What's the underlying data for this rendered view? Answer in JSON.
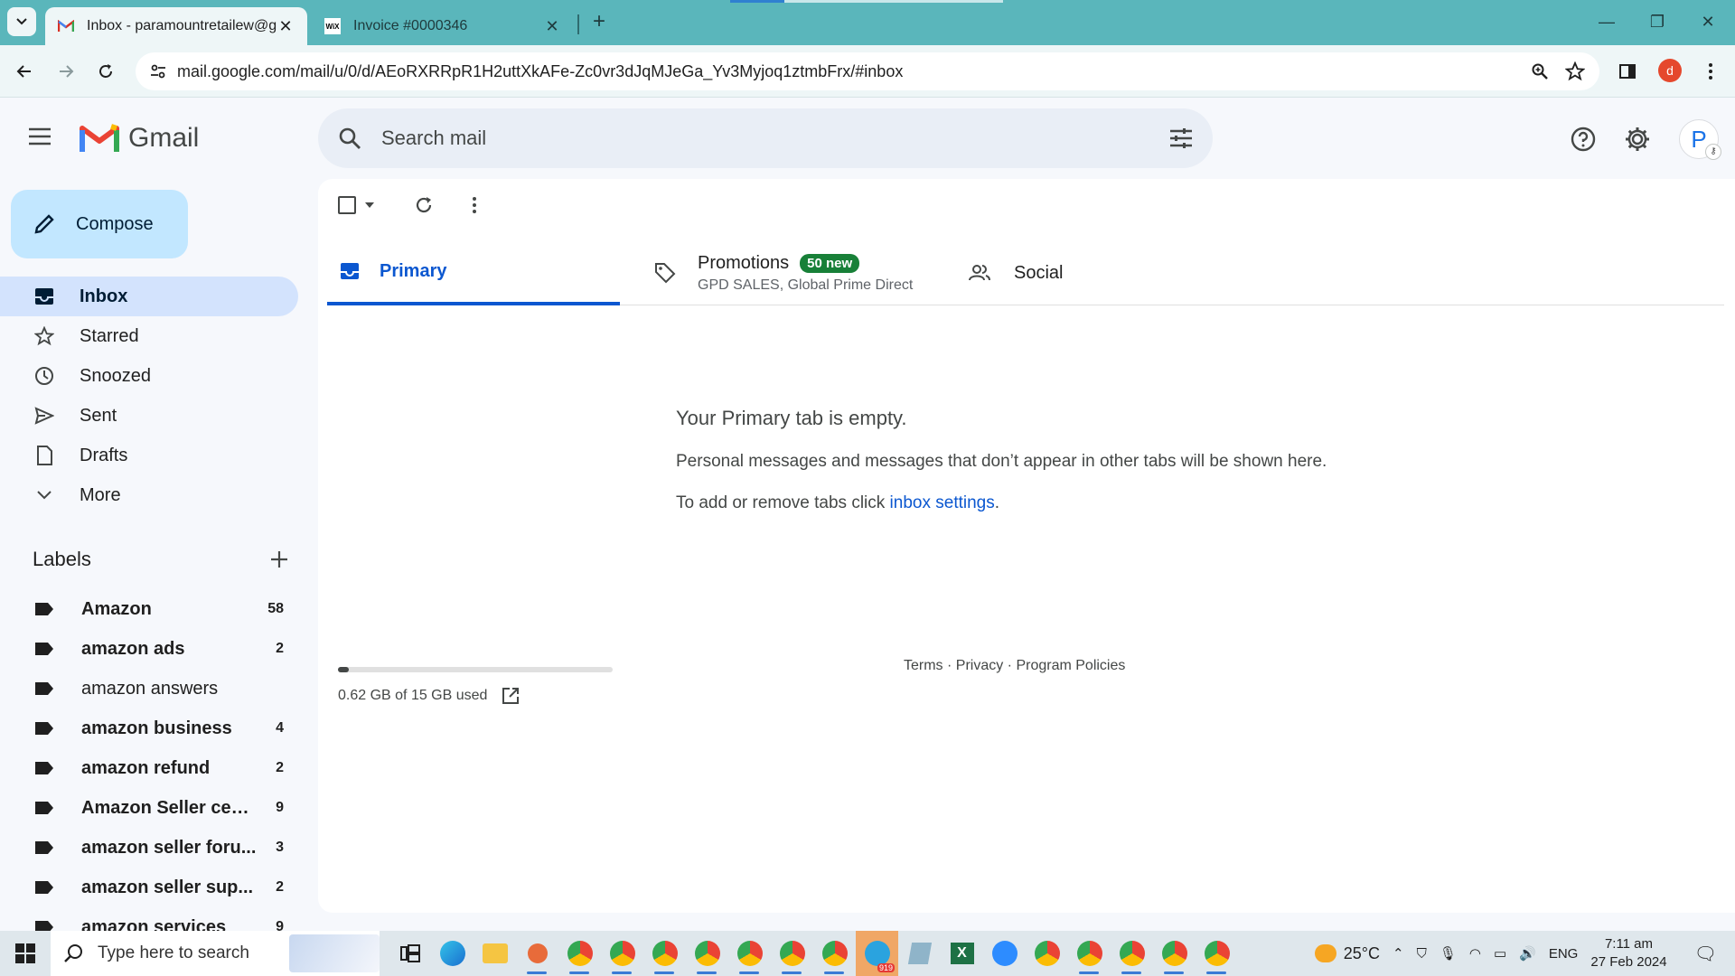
{
  "browser": {
    "tabs": [
      {
        "title": "Inbox - paramountretailew@gm",
        "favicon": "gmail-icon",
        "active": true
      },
      {
        "title": "Invoice #0000346",
        "favicon": "wix-icon",
        "active": false
      }
    ],
    "url": "mail.google.com/mail/u/0/d/AEoRXRRpR1H2uttXkAFe-Zc0vr3dJqMJeGa_Yv3Myjoq1ztmbFrx/#inbox",
    "profile_initial": "d"
  },
  "gmail": {
    "logo_text": "Gmail",
    "search": {
      "placeholder": "Search mail"
    },
    "avatar_initial": "P",
    "compose_label": "Compose",
    "nav": [
      {
        "label": "Inbox",
        "icon": "inbox-icon",
        "active": true
      },
      {
        "label": "Starred",
        "icon": "star-icon"
      },
      {
        "label": "Snoozed",
        "icon": "clock-icon"
      },
      {
        "label": "Sent",
        "icon": "send-icon"
      },
      {
        "label": "Drafts",
        "icon": "draft-icon"
      },
      {
        "label": "More",
        "icon": "chevron-down-icon"
      }
    ],
    "labels_heading": "Labels",
    "labels": [
      {
        "name": "Amazon",
        "count": "58",
        "bold": true
      },
      {
        "name": "amazon ads",
        "count": "2",
        "bold": true
      },
      {
        "name": "amazon answers",
        "count": "",
        "bold": false
      },
      {
        "name": "amazon business",
        "count": "4",
        "bold": true
      },
      {
        "name": "amazon refund",
        "count": "2",
        "bold": true
      },
      {
        "name": "Amazon Seller cent...",
        "count": "9",
        "bold": true
      },
      {
        "name": "amazon seller foru...",
        "count": "3",
        "bold": true
      },
      {
        "name": "amazon seller sup...",
        "count": "2",
        "bold": true
      },
      {
        "name": "amazon services",
        "count": "9",
        "bold": true
      }
    ],
    "tabs": {
      "primary": "Primary",
      "promotions": "Promotions",
      "promotions_badge": "50 new",
      "promotions_senders": "GPD SALES, Global Prime Direct",
      "social": "Social"
    },
    "empty_state": {
      "title": "Your Primary tab is empty.",
      "line1": "Personal messages and messages that don’t appear in other tabs will be shown here.",
      "line2_prefix": "To add or remove tabs click ",
      "line2_link": "inbox settings",
      "line2_suffix": "."
    },
    "storage": {
      "text": "0.62 GB of 15 GB used",
      "used_fraction": 0.04
    },
    "footer": {
      "terms": "Terms",
      "privacy": "Privacy",
      "policies": "Program Policies",
      "sep": " · "
    }
  },
  "taskbar": {
    "search_placeholder": "Type here to search",
    "weather": "25°C",
    "language": "ENG",
    "time": "7:11 am",
    "date": "27 Feb 2024",
    "telegram_badge": "919"
  }
}
